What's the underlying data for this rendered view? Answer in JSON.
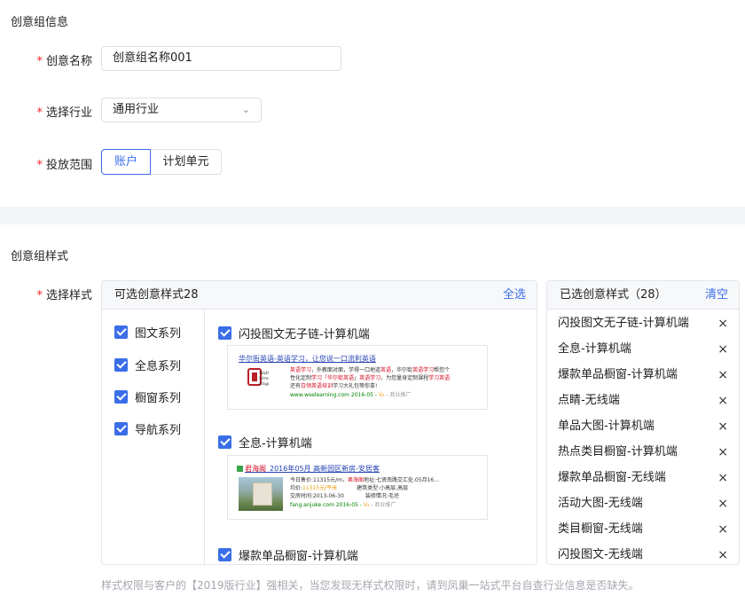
{
  "sections": {
    "info_title": "创意组信息",
    "style_title": "创意组样式"
  },
  "form": {
    "name": {
      "label": "创意名称",
      "value": "创意组名称001"
    },
    "industry": {
      "label": "选择行业",
      "value": "通用行业"
    },
    "scope": {
      "label": "投放范围",
      "options": [
        "账户",
        "计划单元"
      ],
      "selected": "账户"
    },
    "style": {
      "label": "选择样式"
    },
    "required_mark": "*"
  },
  "available": {
    "title": "可选创意样式28",
    "select_all": "全选",
    "categories": [
      "图文系列",
      "全息系列",
      "橱窗系列",
      "导航系列"
    ],
    "styles": [
      "闪投图文无子链-计算机端",
      "全息-计算机端",
      "爆款单品橱窗-计算机端"
    ]
  },
  "preview1": {
    "title": "华尔街英语-英语学习，让您说一口流利英语",
    "line1_a": "英语学习",
    "line1_b": "，外教面对面，学得一口地道",
    "line1_c": "英语",
    "line1_d": "，华尔街",
    "line1_e": "英语学习",
    "line1_f": "帮您个",
    "line2_a": "性化定制",
    "line2_b": "学习「华尔街",
    "line2_c": "英语",
    "line2_d": "」",
    "line2_e": "英语学习",
    "line2_f": "，为您量身定制课程",
    "line2_g": "学习英语",
    "line3_a": "还有",
    "line3_b": "白领英语培训",
    "line3_c": "学习大礼包等你拿!",
    "url": "www.wselearning.com  2016-05",
    "v": "V₂",
    "tag": "- 商业推广",
    "logo_text": "Wall Street English"
  },
  "preview2": {
    "title_a": "君海阁",
    "title_b": "_2016年05月 高新园区新房-安居客",
    "l1": "今日售价:11315元/m，",
    "l1_red": "君海阁",
    "l1_b": "地址:七贤南路交汇处.05月16...",
    "l2_a": "均价:",
    "l2_red": "11315元/平米",
    "l2_b": "建筑类型:",
    "l2_c": "小高层,高层",
    "l3_a": "交房时间:",
    "l3_b": "2013-06-30",
    "l3_c": "装修情况:",
    "l3_d": "毛坯",
    "url": "fang.anjuke.com  2016-05",
    "v": "V₂",
    "tag": "- 商业推广"
  },
  "selected": {
    "title": "已选创意样式（28）",
    "clear": "清空",
    "items": [
      "闪投图文无子链-计算机端",
      "全息-计算机端",
      "爆款单品橱窗-计算机端",
      "点睛-无线端",
      "单品大图-计算机端",
      "热点类目橱窗-计算机端",
      "爆款单品橱窗-无线端",
      "活动大图-无线端",
      "类目橱窗-无线端",
      "闪投图文-无线端"
    ],
    "remove_glyph": "×"
  },
  "hint": "样式权限与客户的【2019版行业】强相关，当您发现无样式权限时，请到凤巢一站式平台自查行业信息是否缺失。",
  "colors": {
    "primary": "#3a6ee8",
    "required": "#f5222d",
    "band": "#f4f5f7"
  }
}
